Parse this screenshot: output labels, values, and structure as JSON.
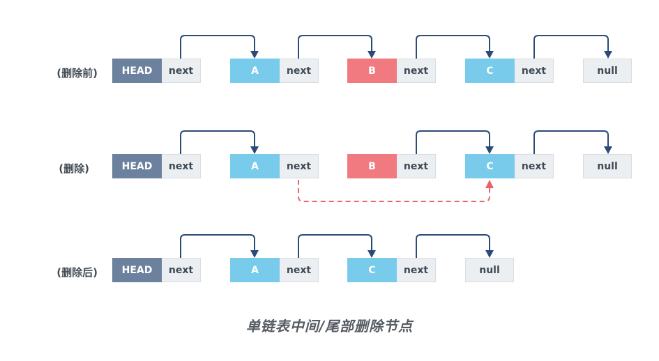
{
  "rows": {
    "before": {
      "label": "(删除前)",
      "head": "HEAD",
      "next": "next",
      "nodes": [
        "A",
        "B",
        "C"
      ],
      "null": "null"
    },
    "deleting": {
      "label": "(删除)",
      "head": "HEAD",
      "next": "next",
      "nodes": [
        "A",
        "B",
        "C"
      ],
      "null": "null"
    },
    "after": {
      "label": "(删除后)",
      "head": "HEAD",
      "next": "next",
      "nodes": [
        "A",
        "C"
      ],
      "null": "null"
    }
  },
  "caption": "单链表中间/尾部删除节点",
  "colors": {
    "head": "#6b819e",
    "normal_node": "#79cbeb",
    "deleted_node": "#f07a7f",
    "next_cell": "#ebeff2",
    "arrow": "#2a4a78",
    "new_link": "#e8646b"
  }
}
